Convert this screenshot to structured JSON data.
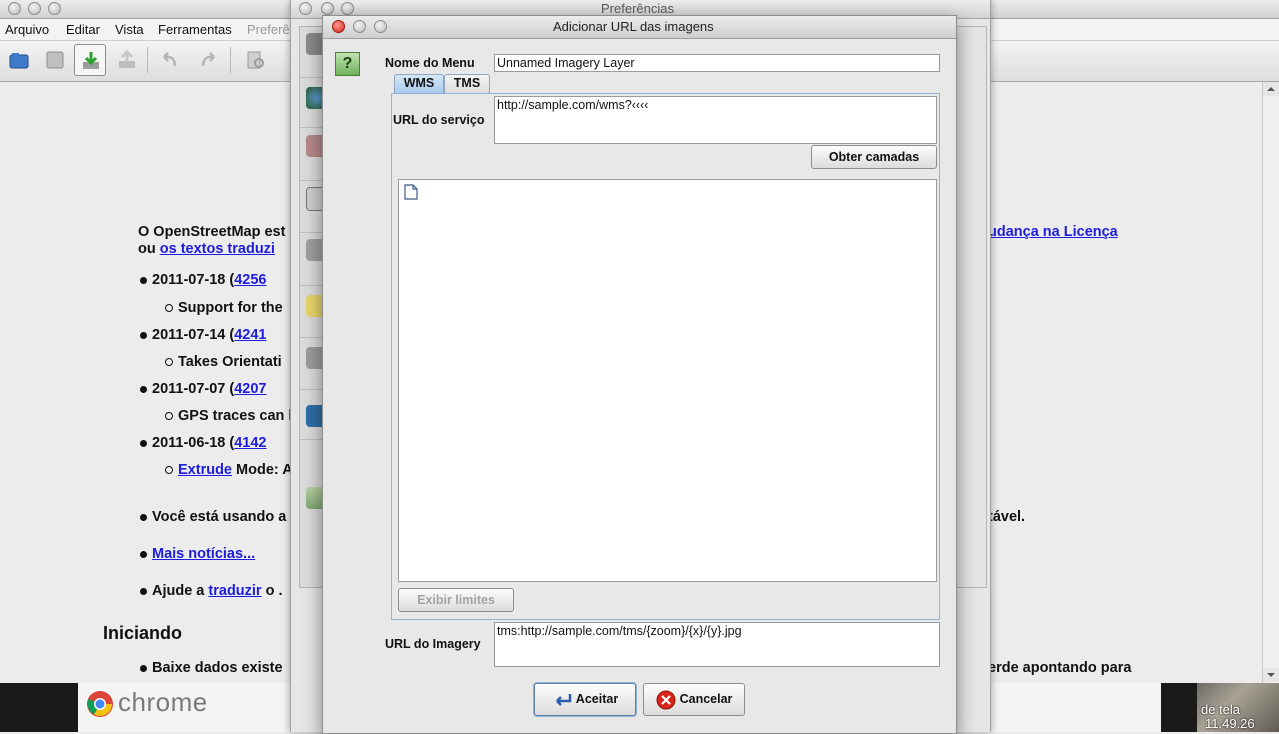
{
  "main_window": {
    "title": "Preferências",
    "menu": [
      "Arquivo",
      "Editar",
      "Vista",
      "Ferramentas",
      "Preferê"
    ]
  },
  "content": {
    "intro_line1_start": "O OpenStreetMap est",
    "intro_line1_link": "udança na Licença",
    "intro_line2_prefix": "ou",
    "intro_line2_link": " os textos traduzi",
    "news": [
      {
        "date": "2011-07-18 (",
        "link": "4256",
        "detail": "Support for the"
      },
      {
        "date": "2011-07-14 (",
        "link": "4241",
        "detail": "Takes Orientati"
      },
      {
        "date": "2011-07-07 (",
        "link": "4207",
        "detail": "GPS traces can l"
      },
      {
        "date": "2011-06-18 (",
        "link": "4142",
        "detail_link": "Extrude",
        "detail": " Mode: A"
      }
    ],
    "using_text": "Você está usando a",
    "using_suffix": "tável.",
    "more_news": "Mais notícias...",
    "help_text": "Ajude a ",
    "help_link": "traduzir",
    "help_suffix": " o .",
    "section_heading": "Iniciando",
    "bottom_line_start": "Baixe dados existe",
    "bottom_line_end": "erde apontando para"
  },
  "taskbar": {
    "chrome_label": "chrome",
    "corner_line1": "de tela",
    "corner_line2": "11.49.26"
  },
  "dialog": {
    "title": "Adicionar URL das imagens",
    "help_glyph": "?",
    "menu_name_label": "Nome do Menu",
    "menu_name_value": "Unnamed Imagery Layer",
    "tabs": [
      "WMS",
      "TMS"
    ],
    "service_url_label": "URL do serviço",
    "service_url_value": "http://sample.com/wms?‹‹‹‹",
    "get_layers_button": "Obter camadas",
    "show_bounds_button": "Exibir limites",
    "imagery_url_label": "URL do Imagery",
    "imagery_url_value": "tms:http://sample.com/tms/{zoom}/{x}/{y}.jpg",
    "accept_button": "Aceitar",
    "cancel_button": "Cancelar"
  }
}
